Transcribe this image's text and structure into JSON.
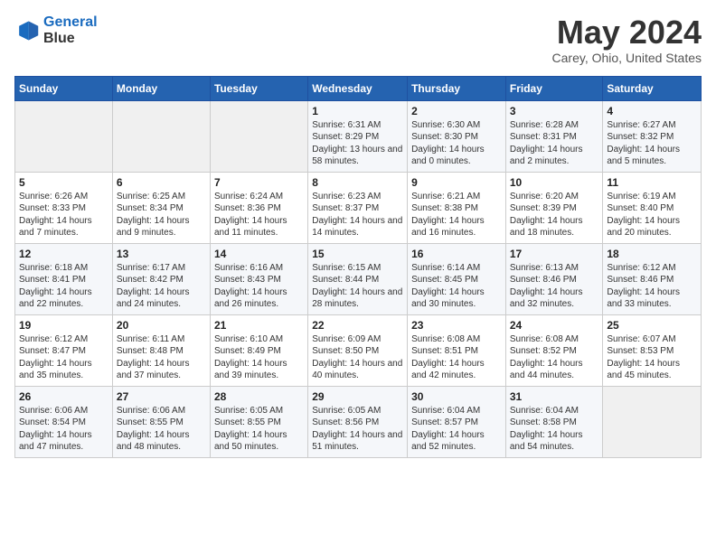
{
  "logo": {
    "line1": "General",
    "line2": "Blue"
  },
  "title": "May 2024",
  "subtitle": "Carey, Ohio, United States",
  "days_of_week": [
    "Sunday",
    "Monday",
    "Tuesday",
    "Wednesday",
    "Thursday",
    "Friday",
    "Saturday"
  ],
  "weeks": [
    [
      {
        "day": "",
        "info": ""
      },
      {
        "day": "",
        "info": ""
      },
      {
        "day": "",
        "info": ""
      },
      {
        "day": "1",
        "info": "Sunrise: 6:31 AM\nSunset: 8:29 PM\nDaylight: 13 hours and 58 minutes."
      },
      {
        "day": "2",
        "info": "Sunrise: 6:30 AM\nSunset: 8:30 PM\nDaylight: 14 hours and 0 minutes."
      },
      {
        "day": "3",
        "info": "Sunrise: 6:28 AM\nSunset: 8:31 PM\nDaylight: 14 hours and 2 minutes."
      },
      {
        "day": "4",
        "info": "Sunrise: 6:27 AM\nSunset: 8:32 PM\nDaylight: 14 hours and 5 minutes."
      }
    ],
    [
      {
        "day": "5",
        "info": "Sunrise: 6:26 AM\nSunset: 8:33 PM\nDaylight: 14 hours and 7 minutes."
      },
      {
        "day": "6",
        "info": "Sunrise: 6:25 AM\nSunset: 8:34 PM\nDaylight: 14 hours and 9 minutes."
      },
      {
        "day": "7",
        "info": "Sunrise: 6:24 AM\nSunset: 8:36 PM\nDaylight: 14 hours and 11 minutes."
      },
      {
        "day": "8",
        "info": "Sunrise: 6:23 AM\nSunset: 8:37 PM\nDaylight: 14 hours and 14 minutes."
      },
      {
        "day": "9",
        "info": "Sunrise: 6:21 AM\nSunset: 8:38 PM\nDaylight: 14 hours and 16 minutes."
      },
      {
        "day": "10",
        "info": "Sunrise: 6:20 AM\nSunset: 8:39 PM\nDaylight: 14 hours and 18 minutes."
      },
      {
        "day": "11",
        "info": "Sunrise: 6:19 AM\nSunset: 8:40 PM\nDaylight: 14 hours and 20 minutes."
      }
    ],
    [
      {
        "day": "12",
        "info": "Sunrise: 6:18 AM\nSunset: 8:41 PM\nDaylight: 14 hours and 22 minutes."
      },
      {
        "day": "13",
        "info": "Sunrise: 6:17 AM\nSunset: 8:42 PM\nDaylight: 14 hours and 24 minutes."
      },
      {
        "day": "14",
        "info": "Sunrise: 6:16 AM\nSunset: 8:43 PM\nDaylight: 14 hours and 26 minutes."
      },
      {
        "day": "15",
        "info": "Sunrise: 6:15 AM\nSunset: 8:44 PM\nDaylight: 14 hours and 28 minutes."
      },
      {
        "day": "16",
        "info": "Sunrise: 6:14 AM\nSunset: 8:45 PM\nDaylight: 14 hours and 30 minutes."
      },
      {
        "day": "17",
        "info": "Sunrise: 6:13 AM\nSunset: 8:46 PM\nDaylight: 14 hours and 32 minutes."
      },
      {
        "day": "18",
        "info": "Sunrise: 6:12 AM\nSunset: 8:46 PM\nDaylight: 14 hours and 33 minutes."
      }
    ],
    [
      {
        "day": "19",
        "info": "Sunrise: 6:12 AM\nSunset: 8:47 PM\nDaylight: 14 hours and 35 minutes."
      },
      {
        "day": "20",
        "info": "Sunrise: 6:11 AM\nSunset: 8:48 PM\nDaylight: 14 hours and 37 minutes."
      },
      {
        "day": "21",
        "info": "Sunrise: 6:10 AM\nSunset: 8:49 PM\nDaylight: 14 hours and 39 minutes."
      },
      {
        "day": "22",
        "info": "Sunrise: 6:09 AM\nSunset: 8:50 PM\nDaylight: 14 hours and 40 minutes."
      },
      {
        "day": "23",
        "info": "Sunrise: 6:08 AM\nSunset: 8:51 PM\nDaylight: 14 hours and 42 minutes."
      },
      {
        "day": "24",
        "info": "Sunrise: 6:08 AM\nSunset: 8:52 PM\nDaylight: 14 hours and 44 minutes."
      },
      {
        "day": "25",
        "info": "Sunrise: 6:07 AM\nSunset: 8:53 PM\nDaylight: 14 hours and 45 minutes."
      }
    ],
    [
      {
        "day": "26",
        "info": "Sunrise: 6:06 AM\nSunset: 8:54 PM\nDaylight: 14 hours and 47 minutes."
      },
      {
        "day": "27",
        "info": "Sunrise: 6:06 AM\nSunset: 8:55 PM\nDaylight: 14 hours and 48 minutes."
      },
      {
        "day": "28",
        "info": "Sunrise: 6:05 AM\nSunset: 8:55 PM\nDaylight: 14 hours and 50 minutes."
      },
      {
        "day": "29",
        "info": "Sunrise: 6:05 AM\nSunset: 8:56 PM\nDaylight: 14 hours and 51 minutes."
      },
      {
        "day": "30",
        "info": "Sunrise: 6:04 AM\nSunset: 8:57 PM\nDaylight: 14 hours and 52 minutes."
      },
      {
        "day": "31",
        "info": "Sunrise: 6:04 AM\nSunset: 8:58 PM\nDaylight: 14 hours and 54 minutes."
      },
      {
        "day": "",
        "info": ""
      }
    ]
  ]
}
